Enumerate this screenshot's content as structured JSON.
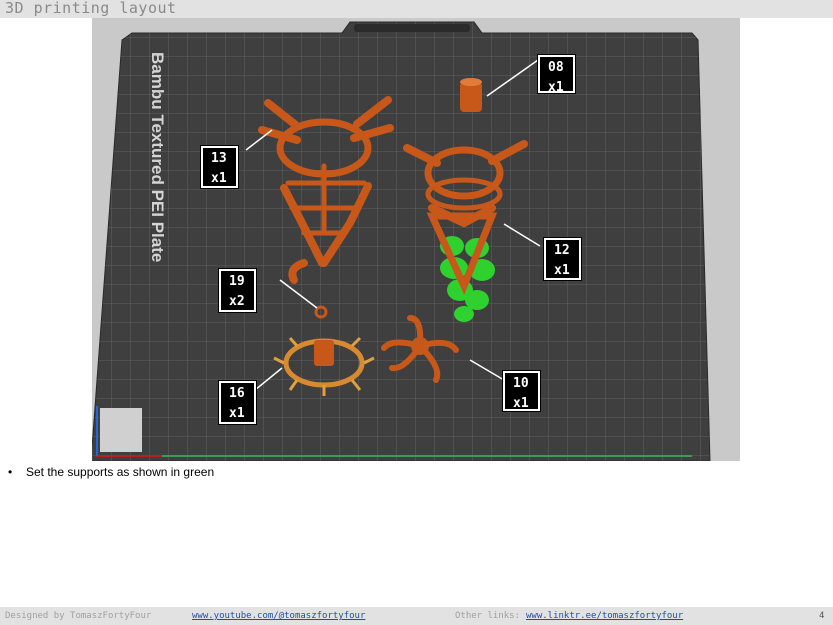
{
  "header": {
    "title": "3D printing layout"
  },
  "plate": {
    "label": "Bambu Textured PEI Plate"
  },
  "callouts": [
    {
      "id": "08",
      "qty": "x1"
    },
    {
      "id": "13",
      "qty": "x1"
    },
    {
      "id": "12",
      "qty": "x1"
    },
    {
      "id": "19",
      "qty": "x2"
    },
    {
      "id": "16",
      "qty": "x1"
    },
    {
      "id": "10",
      "qty": "x1"
    }
  ],
  "notes": {
    "bullet": "Set the supports as shown in green"
  },
  "footer": {
    "designed_by": "Designed by TomaszFortyFour",
    "youtube": "www.youtube.com/@tomaszfortyfour",
    "other_links_label": "Other links:",
    "linktree": "www.linktr.ee/tomaszfortyfour",
    "page": "4"
  },
  "colors": {
    "part": "#c8581a",
    "support": "#2fd12f",
    "plate": "#3f3f3f",
    "grid": "#8c8c8c"
  }
}
